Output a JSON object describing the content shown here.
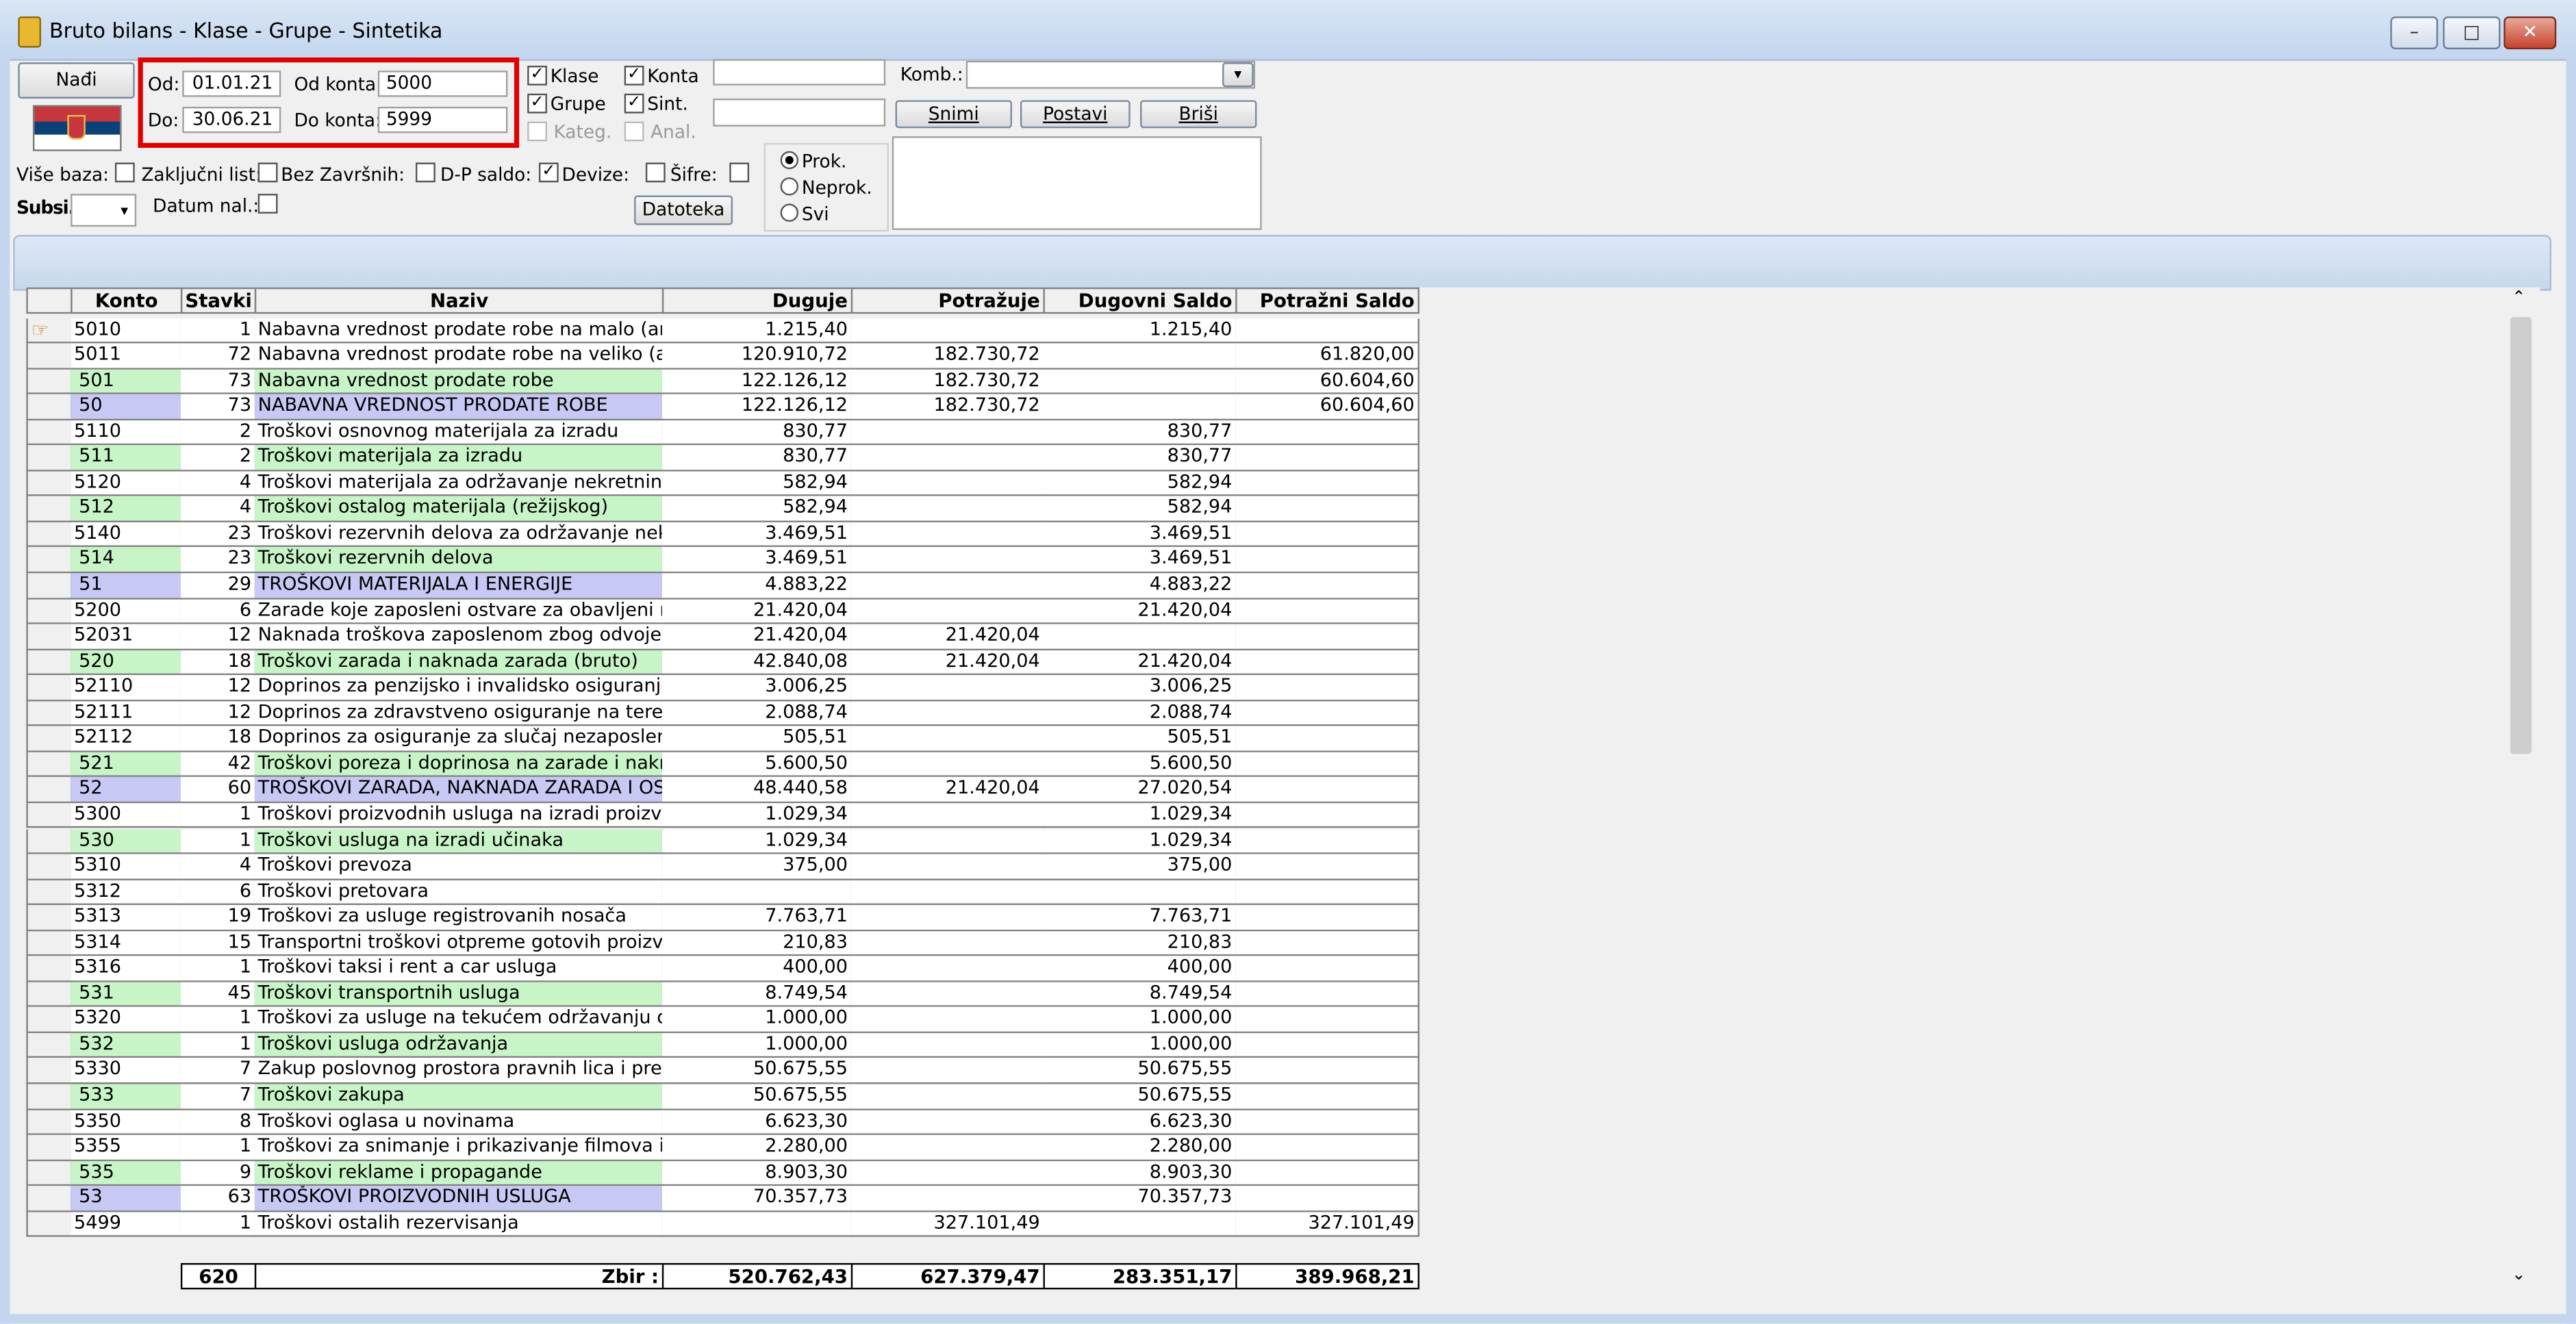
{
  "window": {
    "title": "Bruto bilans - Klase - Grupe - Sintetika",
    "controls": [
      "–",
      "□",
      "✕"
    ]
  },
  "toolbar": {
    "find_label": "Nađi",
    "od_label": "Od:",
    "od_value": "01.01.21",
    "do_label": "Do:",
    "do_value": "30.06.21",
    "od_konta_label": "Od konta:",
    "od_konta_value": "5000",
    "do_konta_label": "Do konta:",
    "do_konta_value": "5999",
    "klase": "Klase",
    "konta": "Konta",
    "grupe": "Grupe",
    "sint": "Sint.",
    "kateg": "Kateg.",
    "anal": "Anal.",
    "komb_label": "Komb.:",
    "snimi": "Snimi",
    "postavi": "Postavi",
    "brisi": "Briši",
    "vise_baza": "Više baza:",
    "zakljucni": "Zaključni list:",
    "bez_zavrsnih": "Bez Završnih:",
    "dp_saldo": "D-P saldo:",
    "devize": "Devize:",
    "sifre": "Šifre:",
    "subsi": "Subsi.:",
    "datum_nal": "Datum nal.:",
    "datoteka": "Datoteka",
    "prok": "Prok.",
    "neprok": "Neprok.",
    "svi": "Svi"
  },
  "table": {
    "headers": [
      "Konto",
      "Stavki",
      "Naziv",
      "Duguje",
      "Potražuje",
      "Dugovni Saldo",
      "Potražni Saldo"
    ],
    "rows": [
      {
        "konto": "5010",
        "stavki": "1",
        "naziv": "Nabavna vrednost prodate robe na malo (analitik",
        "duguje": "1.215,40",
        "potrazuje": "",
        "dug_saldo": "1.215,40",
        "pot_saldo": "",
        "type": "k"
      },
      {
        "konto": "5011",
        "stavki": "72",
        "naziv": "Nabavna vrednost prodate robe na veliko (analiti",
        "duguje": "120.910,72",
        "potrazuje": "182.730,72",
        "dug_saldo": "",
        "pot_saldo": "61.820,00",
        "type": "k"
      },
      {
        "konto": "501",
        "stavki": "73",
        "naziv": "Nabavna vrednost prodate robe",
        "duguje": "122.126,12",
        "potrazuje": "182.730,72",
        "dug_saldo": "",
        "pot_saldo": "60.604,60",
        "type": "sint"
      },
      {
        "konto": "50",
        "stavki": "73",
        "naziv": "NABAVNA VREDNOST PRODATE ROBE",
        "duguje": "122.126,12",
        "potrazuje": "182.730,72",
        "dug_saldo": "",
        "pot_saldo": "60.604,60",
        "type": "grp"
      },
      {
        "konto": "5110",
        "stavki": "2",
        "naziv": "Troškovi osnovnog materijala za izradu",
        "duguje": "830,77",
        "potrazuje": "",
        "dug_saldo": "830,77",
        "pot_saldo": "",
        "type": "k"
      },
      {
        "konto": "511",
        "stavki": "2",
        "naziv": "Troškovi materijala za izradu",
        "duguje": "830,77",
        "potrazuje": "",
        "dug_saldo": "830,77",
        "pot_saldo": "",
        "type": "sint"
      },
      {
        "konto": "5120",
        "stavki": "4",
        "naziv": "Troškovi materijala za održavanje nekretnina, pos",
        "duguje": "582,94",
        "potrazuje": "",
        "dug_saldo": "582,94",
        "pot_saldo": "",
        "type": "k"
      },
      {
        "konto": "512",
        "stavki": "4",
        "naziv": "Troškovi ostalog materijala (režijskog)",
        "duguje": "582,94",
        "potrazuje": "",
        "dug_saldo": "582,94",
        "pot_saldo": "",
        "type": "sint"
      },
      {
        "konto": "5140",
        "stavki": "23",
        "naziv": "Troškovi rezervnih delova za održavanje nekretni",
        "duguje": "3.469,51",
        "potrazuje": "",
        "dug_saldo": "3.469,51",
        "pot_saldo": "",
        "type": "k"
      },
      {
        "konto": "514",
        "stavki": "23",
        "naziv": "Troškovi rezervnih delova",
        "duguje": "3.469,51",
        "potrazuje": "",
        "dug_saldo": "3.469,51",
        "pot_saldo": "",
        "type": "sint"
      },
      {
        "konto": "51",
        "stavki": "29",
        "naziv": "TROŠKOVI MATERIJALA I ENERGIJE",
        "duguje": "4.883,22",
        "potrazuje": "",
        "dug_saldo": "4.883,22",
        "pot_saldo": "",
        "type": "grp"
      },
      {
        "konto": "5200",
        "stavki": "6",
        "naziv": "Zarade koje zaposleni ostvare za obavljeni rad i v",
        "duguje": "21.420,04",
        "potrazuje": "",
        "dug_saldo": "21.420,04",
        "pot_saldo": "",
        "type": "k"
      },
      {
        "konto": "52031",
        "stavki": "12",
        "naziv": "Naknada troškova zaposlenom zbog odvojenog ži",
        "duguje": "21.420,04",
        "potrazuje": "21.420,04",
        "dug_saldo": "",
        "pot_saldo": "",
        "type": "k"
      },
      {
        "konto": "520",
        "stavki": "18",
        "naziv": "Troškovi zarada i naknada zarada (bruto)",
        "duguje": "42.840,08",
        "potrazuje": "21.420,04",
        "dug_saldo": "21.420,04",
        "pot_saldo": "",
        "type": "sint"
      },
      {
        "konto": "52110",
        "stavki": "12",
        "naziv": "Doprinos za penzijsko i invalidsko osiguranje",
        "duguje": "3.006,25",
        "potrazuje": "",
        "dug_saldo": "3.006,25",
        "pot_saldo": "",
        "type": "k"
      },
      {
        "konto": "52111",
        "stavki": "12",
        "naziv": "Doprinos za zdravstveno osiguranje na teret posl",
        "duguje": "2.088,74",
        "potrazuje": "",
        "dug_saldo": "2.088,74",
        "pot_saldo": "",
        "type": "k"
      },
      {
        "konto": "52112",
        "stavki": "18",
        "naziv": "Doprinos za osiguranje za slučaj nezaposlenosti n",
        "duguje": "505,51",
        "potrazuje": "",
        "dug_saldo": "505,51",
        "pot_saldo": "",
        "type": "k"
      },
      {
        "konto": "521",
        "stavki": "42",
        "naziv": "Troškovi poreza i doprinosa na zarade i naknade z",
        "duguje": "5.600,50",
        "potrazuje": "",
        "dug_saldo": "5.600,50",
        "pot_saldo": "",
        "type": "sint"
      },
      {
        "konto": "52",
        "stavki": "60",
        "naziv": "TROŠKOVI ZARADA, NAKNADA ZARADA I OSTAL",
        "duguje": "48.440,58",
        "potrazuje": "21.420,04",
        "dug_saldo": "27.020,54",
        "pot_saldo": "",
        "type": "grp"
      },
      {
        "konto": "5300",
        "stavki": "1",
        "naziv": "Troškovi proizvodnih usluga na izradi proizvoda",
        "duguje": "1.029,34",
        "potrazuje": "",
        "dug_saldo": "1.029,34",
        "pot_saldo": "",
        "type": "k"
      },
      {
        "konto": "530",
        "stavki": "1",
        "naziv": "Troškovi usluga na izradi učinaka",
        "duguje": "1.029,34",
        "potrazuje": "",
        "dug_saldo": "1.029,34",
        "pot_saldo": "",
        "type": "sint"
      },
      {
        "konto": "5310",
        "stavki": "4",
        "naziv": "Troškovi prevoza",
        "duguje": "375,00",
        "potrazuje": "",
        "dug_saldo": "375,00",
        "pot_saldo": "",
        "type": "k"
      },
      {
        "konto": "5312",
        "stavki": "6",
        "naziv": "Troškovi pretovara",
        "duguje": "",
        "potrazuje": "",
        "dug_saldo": "",
        "pot_saldo": "",
        "type": "k"
      },
      {
        "konto": "5313",
        "stavki": "19",
        "naziv": "Troškovi za usluge registrovanih nosača",
        "duguje": "7.763,71",
        "potrazuje": "",
        "dug_saldo": "7.763,71",
        "pot_saldo": "",
        "type": "k"
      },
      {
        "konto": "5314",
        "stavki": "15",
        "naziv": "Transportni troškovi otpreme gotovih proizvoda d",
        "duguje": "210,83",
        "potrazuje": "",
        "dug_saldo": "210,83",
        "pot_saldo": "",
        "type": "k"
      },
      {
        "konto": "5316",
        "stavki": "1",
        "naziv": "Troškovi taksi i rent a car usluga",
        "duguje": "400,00",
        "potrazuje": "",
        "dug_saldo": "400,00",
        "pot_saldo": "",
        "type": "k"
      },
      {
        "konto": "531",
        "stavki": "45",
        "naziv": "Troškovi transportnih usluga",
        "duguje": "8.749,54",
        "potrazuje": "",
        "dug_saldo": "8.749,54",
        "pot_saldo": "",
        "type": "sint"
      },
      {
        "konto": "5320",
        "stavki": "1",
        "naziv": "Troškovi za usluge na tekućem održavanju osnov",
        "duguje": "1.000,00",
        "potrazuje": "",
        "dug_saldo": "1.000,00",
        "pot_saldo": "",
        "type": "k"
      },
      {
        "konto": "532",
        "stavki": "1",
        "naziv": "Troškovi usluga održavanja",
        "duguje": "1.000,00",
        "potrazuje": "",
        "dug_saldo": "1.000,00",
        "pot_saldo": "",
        "type": "sint"
      },
      {
        "konto": "5330",
        "stavki": "7",
        "naziv": "Zakup poslovnog prostora pravnih lica i preduzetr",
        "duguje": "50.675,55",
        "potrazuje": "",
        "dug_saldo": "50.675,55",
        "pot_saldo": "",
        "type": "k"
      },
      {
        "konto": "533",
        "stavki": "7",
        "naziv": "Troškovi zakupa",
        "duguje": "50.675,55",
        "potrazuje": "",
        "dug_saldo": "50.675,55",
        "pot_saldo": "",
        "type": "sint"
      },
      {
        "konto": "5350",
        "stavki": "8",
        "naziv": "Troškovi oglasa u novinama",
        "duguje": "6.623,30",
        "potrazuje": "",
        "dug_saldo": "6.623,30",
        "pot_saldo": "",
        "type": "k"
      },
      {
        "konto": "5355",
        "stavki": "1",
        "naziv": "Troškovi za snimanje i prikazivanje filmova i video",
        "duguje": "2.280,00",
        "potrazuje": "",
        "dug_saldo": "2.280,00",
        "pot_saldo": "",
        "type": "k"
      },
      {
        "konto": "535",
        "stavki": "9",
        "naziv": "Troškovi reklame i propagande",
        "duguje": "8.903,30",
        "potrazuje": "",
        "dug_saldo": "8.903,30",
        "pot_saldo": "",
        "type": "sint"
      },
      {
        "konto": "53",
        "stavki": "63",
        "naziv": "TROŠKOVI PROIZVODNIH USLUGA",
        "duguje": "70.357,73",
        "potrazuje": "",
        "dug_saldo": "70.357,73",
        "pot_saldo": "",
        "type": "grp"
      },
      {
        "konto": "5499",
        "stavki": "1",
        "naziv": "Troškovi ostalih rezervisanja",
        "duguje": "",
        "potrazuje": "327.101,49",
        "dug_saldo": "",
        "pot_saldo": "327.101,49",
        "type": "k"
      }
    ],
    "footer": {
      "stavki": "620",
      "label": "Zbir :",
      "duguje": "520.762,43",
      "potrazuje": "627.379,47",
      "dug_saldo": "283.351,17",
      "pot_saldo": "389.968,21"
    }
  }
}
